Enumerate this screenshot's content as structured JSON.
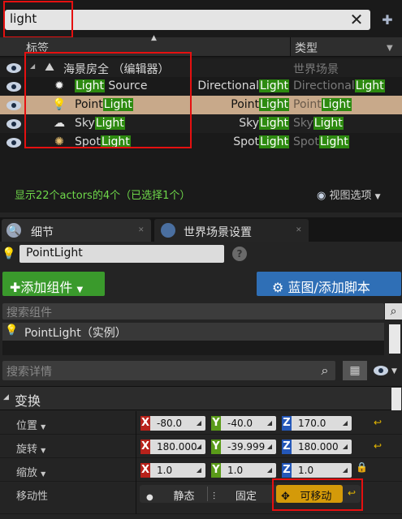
{
  "outliner": {
    "search_value": "light",
    "col_label": "标签",
    "col_type": "类型",
    "rows": [
      {
        "name_pre": "海景房全 （编辑器）",
        "name_hl": "",
        "name_post": "",
        "mid_pre": "",
        "mid_hl": "",
        "type_pre": "世界场景",
        "type_hl": ""
      },
      {
        "name_pre": "",
        "name_hl": "Light",
        "name_post": " Source",
        "mid_pre": "Directional",
        "mid_hl": "Light",
        "type_pre": "Directional",
        "type_hl": "Light"
      },
      {
        "name_pre": "Point",
        "name_hl": "Light",
        "name_post": "",
        "mid_pre": "Point",
        "mid_hl": "Light",
        "type_pre": "Point",
        "type_hl": "Light"
      },
      {
        "name_pre": "Sky",
        "name_hl": "Light",
        "name_post": "",
        "mid_pre": "Sky",
        "mid_hl": "Light",
        "type_pre": "Sky",
        "type_hl": "Light"
      },
      {
        "name_pre": "Spot",
        "name_hl": "Light",
        "name_post": "",
        "mid_pre": "Spot",
        "mid_hl": "Light",
        "type_pre": "Spot",
        "type_hl": "Light"
      }
    ],
    "status": "显示22个actors的4个（已选择1个）",
    "view_options": "视图选项"
  },
  "tabs": [
    {
      "label": "细节"
    },
    {
      "label": "世界场景设置"
    }
  ],
  "details": {
    "actor_name": "PointLight",
    "add_component": "添加组件",
    "blueprint_button": "蓝图/添加脚本",
    "component_search_placeholder": "搜索组件",
    "component_root": "PointLight（实例）",
    "detail_search_placeholder": "搜索详情",
    "transform_section": "变换",
    "properties": [
      {
        "label": "位置",
        "x": "-80.0",
        "y": "-40.0",
        "z": "170.0"
      },
      {
        "label": "旋转",
        "x": "180.000",
        "y": "-39.999",
        "z": "180.000"
      },
      {
        "label": "缩放",
        "x": "1.0",
        "y": "1.0",
        "z": "1.0"
      }
    ],
    "mobility_label": "移动性",
    "mobility_options": [
      "静态",
      "固定",
      "可移动"
    ],
    "mobility_selected": "可移动"
  },
  "colors": {
    "highlight": "#2d8a10",
    "selected_row": "#c8a98a",
    "annotation_red": "#e51010",
    "movable_active": "#d49a09"
  },
  "icons": [
    "eye-icon",
    "clear-icon",
    "add-filter-icon",
    "sun-icon",
    "bulb-icon",
    "sky-icon",
    "spot-icon",
    "help-icon",
    "plus-icon",
    "gear-icon",
    "search-icon",
    "grid-icon",
    "reset-icon",
    "lock-icon"
  ]
}
